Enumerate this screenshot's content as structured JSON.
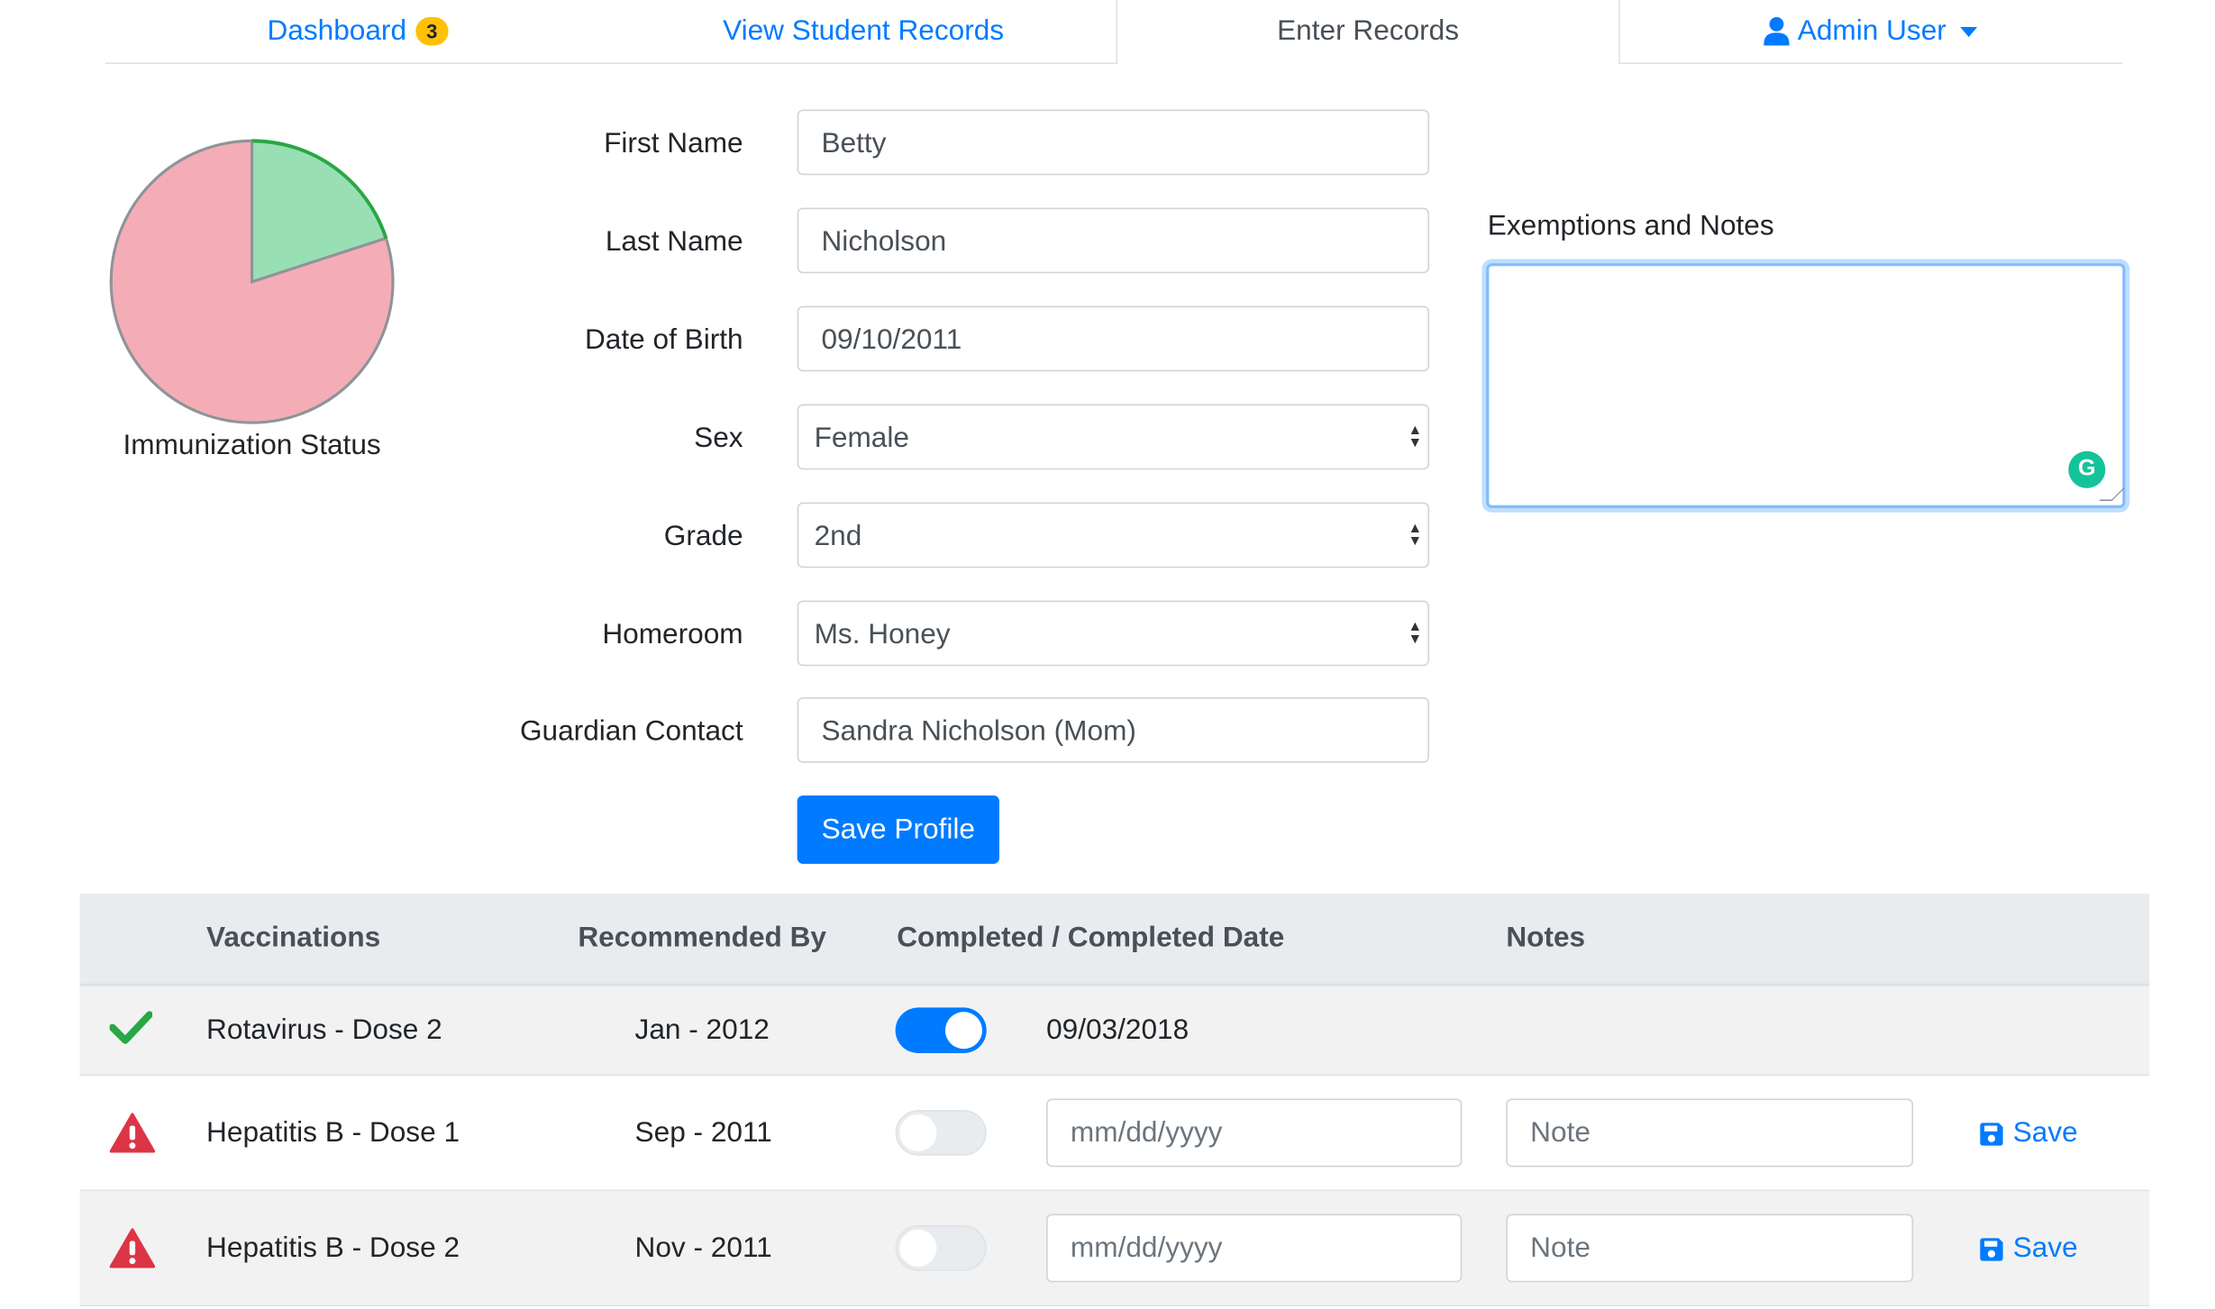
{
  "nav": {
    "dashboard_label": "Dashboard",
    "dashboard_badge": "3",
    "view_records_label": "View Student Records",
    "enter_records_label": "Enter Records",
    "admin_label": "Admin User"
  },
  "immunization": {
    "label": "Immunization Status",
    "completed_fraction": 0.2,
    "colors": {
      "complete": "#99dfb4",
      "incomplete": "#f4adb6"
    }
  },
  "form": {
    "first_name": {
      "label": "First Name",
      "value": "Betty"
    },
    "last_name": {
      "label": "Last Name",
      "value": "Nicholson"
    },
    "dob": {
      "label": "Date of Birth",
      "value": "09/10/2011"
    },
    "sex": {
      "label": "Sex",
      "value": "Female"
    },
    "grade": {
      "label": "Grade",
      "value": "2nd"
    },
    "homeroom": {
      "label": "Homeroom",
      "value": "Ms. Honey"
    },
    "guardian": {
      "label": "Guardian Contact",
      "value": "Sandra Nicholson (Mom)"
    },
    "save_label": "Save Profile"
  },
  "notes": {
    "label": "Exemptions and Notes",
    "value": ""
  },
  "table": {
    "headers": {
      "vaccinations": "Vaccinations",
      "recommended": "Recommended By",
      "completed": "Completed / Completed Date",
      "notes": "Notes"
    },
    "rows": [
      {
        "status": "complete",
        "name": "Rotavirus - Dose 2",
        "recommended": "Jan - 2012",
        "completed": true,
        "completed_date": "09/03/2018"
      },
      {
        "status": "warning",
        "name": "Hepatitis B - Dose 1",
        "recommended": "Sep - 2011",
        "completed": false,
        "date_placeholder": "mm/dd/yyyy",
        "note_placeholder": "Note",
        "save_label": "Save"
      },
      {
        "status": "warning",
        "name": "Hepatitis B - Dose 2",
        "recommended": "Nov - 2011",
        "completed": false,
        "date_placeholder": "mm/dd/yyyy",
        "note_placeholder": "Note",
        "save_label": "Save"
      }
    ]
  },
  "colors": {
    "primary": "#007bff",
    "success": "#28a745",
    "danger": "#dc3545",
    "badge": "#ffc107"
  }
}
